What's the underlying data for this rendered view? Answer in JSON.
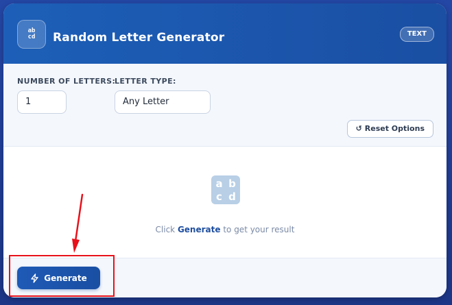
{
  "header": {
    "icon_letters": [
      "a",
      "b",
      "c",
      "d"
    ],
    "title": "Random Letter Generator",
    "badge": "TEXT"
  },
  "options": {
    "count_label": "NUMBER OF LETTERS:",
    "count_value": "1",
    "type_label": "LETTER TYPE:",
    "type_value": "Any Letter",
    "reset_label": "Reset Options"
  },
  "result": {
    "icon_letters": [
      "a",
      "b",
      "c",
      "d"
    ],
    "hint_prefix": "Click",
    "hint_action": "Generate",
    "hint_suffix": "to get your result"
  },
  "footer": {
    "generate_label": "Generate"
  },
  "annotation": {
    "color": "#e8101a"
  }
}
